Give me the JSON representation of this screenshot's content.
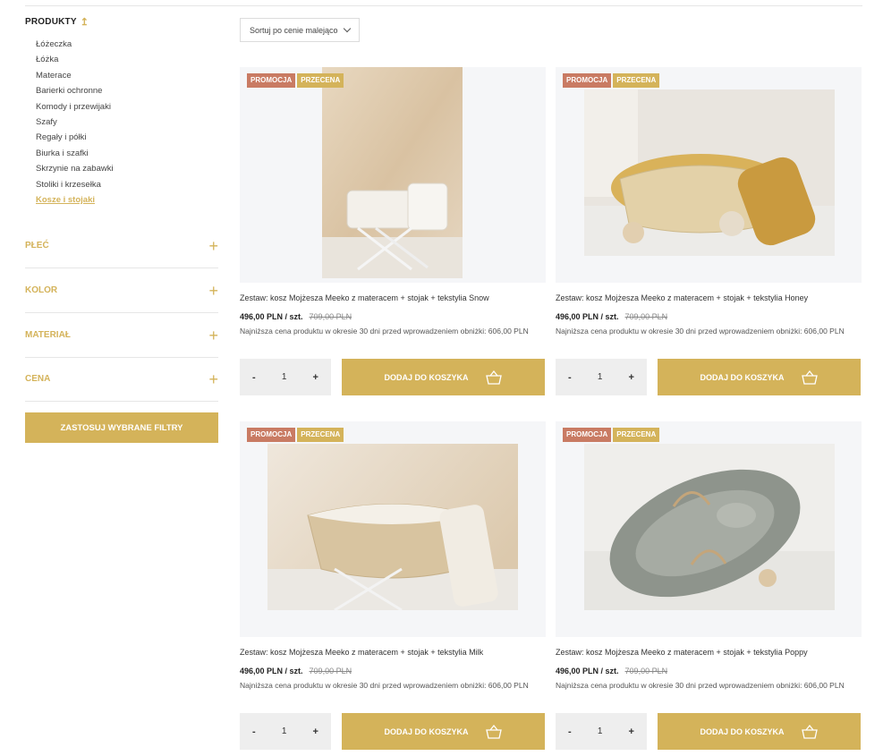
{
  "sidebar": {
    "category_heading": "PRODUKTY",
    "categories": [
      {
        "label": "Łóżeczka"
      },
      {
        "label": "Łóżka"
      },
      {
        "label": "Materace"
      },
      {
        "label": "Barierki ochronne"
      },
      {
        "label": "Komody i przewijaki"
      },
      {
        "label": "Szafy"
      },
      {
        "label": "Regały i półki"
      },
      {
        "label": "Biurka i szafki"
      },
      {
        "label": "Skrzynie na zabawki"
      },
      {
        "label": "Stoliki i krzesełka"
      },
      {
        "label": "Kosze i stojaki",
        "active": true
      }
    ],
    "filters": [
      "PŁEĆ",
      "KOLOR",
      "MATERIAŁ",
      "CENA"
    ],
    "apply_label": "ZASTOSUJ WYBRANE FILTRY"
  },
  "sort": {
    "label": "Sortuj po cenie malejąco"
  },
  "badges": {
    "promo": "PROMOCJA",
    "sale": "PRZECENA"
  },
  "add_label": "DODAJ DO KOSZYKA",
  "qty_minus": "-",
  "qty_plus": "+",
  "products": [
    {
      "title": "Zestaw: kosz Mojżesza Meeko z materacem + stojak + tekstylia Snow",
      "price": "496,00 PLN / szt.",
      "old_price": "709,00 PLN",
      "lowest": "Najniższa cena produktu w okresie 30 dni przed wprowadzeniem obniżki: 606,00 PLN",
      "qty": "1"
    },
    {
      "title": "Zestaw: kosz Mojżesza Meeko z materacem + stojak + tekstylia Honey",
      "price": "496,00 PLN / szt.",
      "old_price": "709,00 PLN",
      "lowest": "Najniższa cena produktu w okresie 30 dni przed wprowadzeniem obniżki: 606,00 PLN",
      "qty": "1"
    },
    {
      "title": "Zestaw: kosz Mojżesza Meeko z materacem + stojak + tekstylia Milk",
      "price": "496,00 PLN / szt.",
      "old_price": "709,00 PLN",
      "lowest": "Najniższa cena produktu w okresie 30 dni przed wprowadzeniem obniżki: 606,00 PLN",
      "qty": "1"
    },
    {
      "title": "Zestaw: kosz Mojżesza Meeko z materacem + stojak + tekstylia Poppy",
      "price": "496,00 PLN / szt.",
      "old_price": "709,00 PLN",
      "lowest": "Najniższa cena produktu w okresie 30 dni przed wprowadzeniem obniżki: 606,00 PLN",
      "qty": "1"
    }
  ],
  "colors": {
    "accent": "#d4b35a",
    "promo": "#c97b63"
  }
}
